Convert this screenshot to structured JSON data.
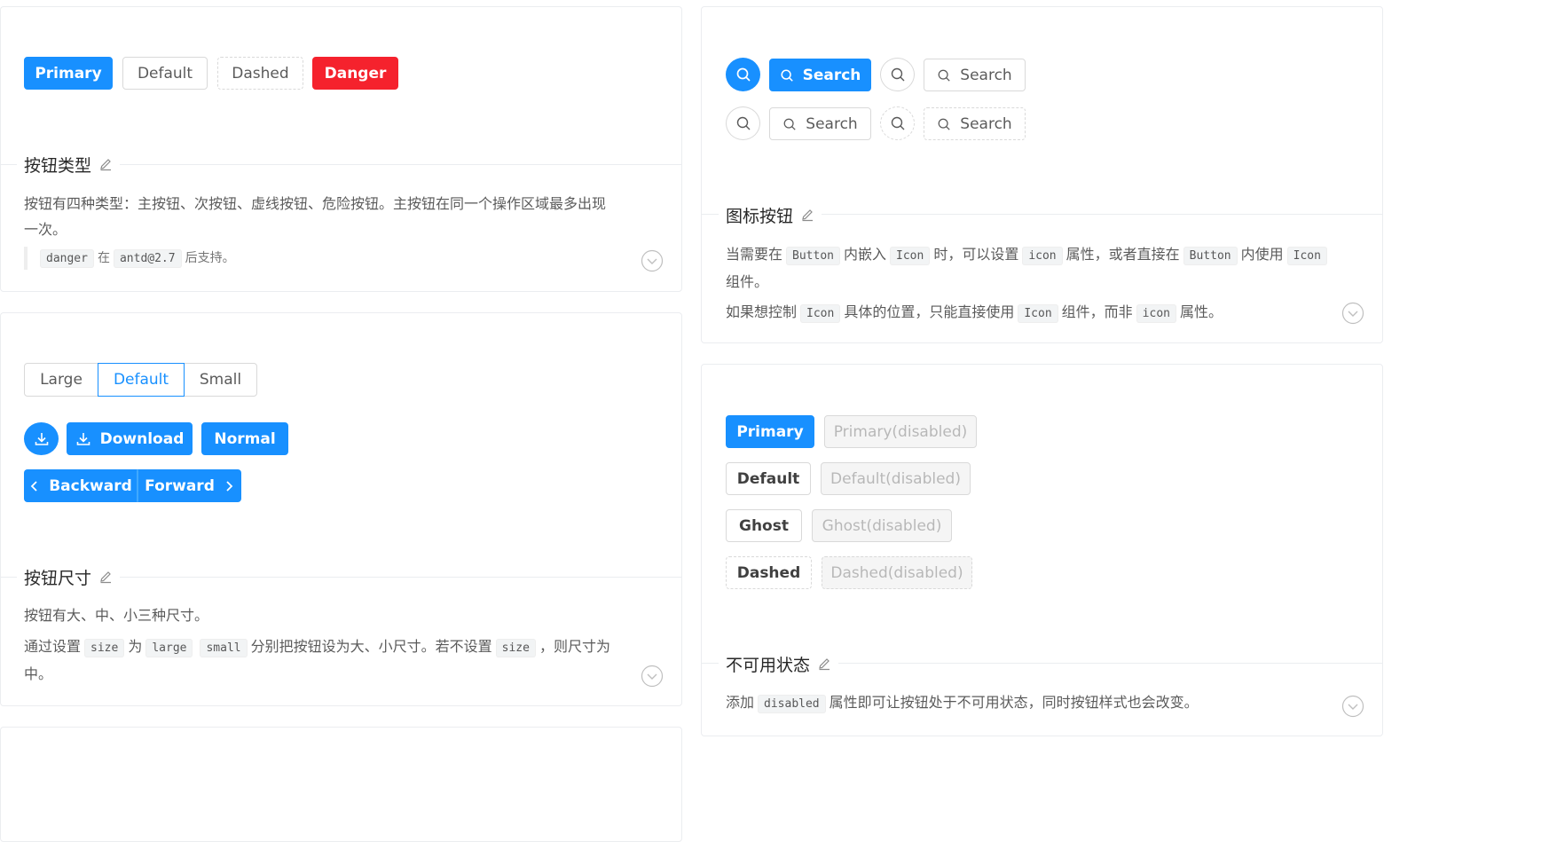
{
  "colors": {
    "primary": "#1890ff",
    "danger": "#f5222d",
    "border": "#d9d9d9",
    "disabled_bg": "#f5f5f5"
  },
  "card1": {
    "buttons": {
      "primary": "Primary",
      "default": "Default",
      "dashed": "Dashed",
      "danger": "Danger"
    },
    "title": "按钮类型",
    "desc_line1": "按钮有四种类型：主按钮、次按钮、虚线按钮、危险按钮。主按钮在同一个操作区域最多出现一次。",
    "note": {
      "code1": "danger",
      "text1": "在",
      "code2": "antd@2.7",
      "text2": "后支持。"
    }
  },
  "card2": {
    "sizes": [
      "Large",
      "Default",
      "Small"
    ],
    "selected_size": "Default",
    "download_label": "Download",
    "normal_label": "Normal",
    "backward_label": "Backward",
    "forward_label": "Forward",
    "title": "按钮尺寸",
    "desc_line1": "按钮有大、中、小三种尺寸。",
    "desc2": {
      "t1": "通过设置",
      "c1": "size",
      "t2": "为",
      "c2": "large",
      "c3": "small",
      "t3": "分别把按钮设为大、小尺寸。若不设置",
      "c4": "size",
      "t4": "，则尺寸为中。"
    }
  },
  "card3": {
    "search_label": "Search",
    "title": "图标按钮",
    "desc1": {
      "t1": "当需要在",
      "c1": "Button",
      "t2": "内嵌入",
      "c2": "Icon",
      "t3": "时，可以设置",
      "c3": "icon",
      "t4": "属性，或者直接在",
      "c4": "Button",
      "t5": "内使用",
      "c5": "Icon",
      "t6": "组件。"
    },
    "desc2": {
      "t1": "如果想控制",
      "c1": "Icon",
      "t2": "具体的位置，只能直接使用",
      "c2": "Icon",
      "t3": "组件，而非",
      "c3": "icon",
      "t4": "属性。"
    }
  },
  "card4": {
    "rows": [
      {
        "label": "Primary",
        "disabled_label": "Primary(disabled)"
      },
      {
        "label": "Default",
        "disabled_label": "Default(disabled)"
      },
      {
        "label": "Ghost",
        "disabled_label": "Ghost(disabled)"
      },
      {
        "label": "Dashed",
        "disabled_label": "Dashed(disabled)"
      }
    ],
    "title": "不可用状态",
    "desc": {
      "t1": "添加",
      "c1": "disabled",
      "t2": "属性即可让按钮处于不可用状态，同时按钮样式也会改变。"
    }
  }
}
